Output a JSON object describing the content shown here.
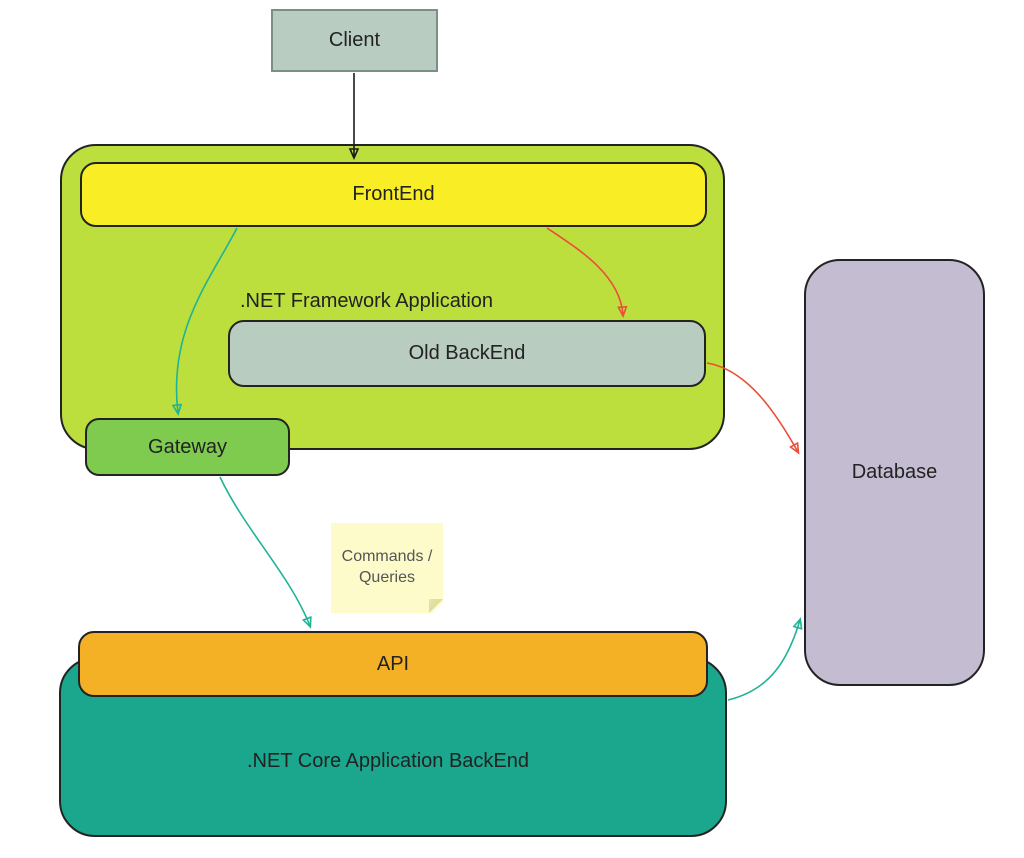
{
  "nodes": {
    "client": {
      "label": "Client"
    },
    "frontend": {
      "label": "FrontEnd"
    },
    "net_framework_app": {
      "label": ".NET Framework Application"
    },
    "old_backend": {
      "label": "Old BackEnd"
    },
    "gateway": {
      "label": "Gateway"
    },
    "api": {
      "label": "API"
    },
    "net_core_backend": {
      "label": ".NET Core Application BackEnd"
    },
    "database": {
      "label": "Database"
    }
  },
  "notes": {
    "commands_queries": {
      "text": "Commands / Queries"
    }
  },
  "colors": {
    "client_fill": "#b9ccc2",
    "client_stroke": "#7a8f85",
    "framework_fill": "#bcdf3e",
    "framework_stroke": "#232323",
    "frontend_fill": "#f9ee26",
    "frontend_stroke": "#232323",
    "old_backend_fill": "#b8ccc0",
    "old_backend_stroke": "#232323",
    "gateway_fill": "#7ecb4f",
    "gateway_stroke": "#232323",
    "core_fill": "#1aa78e",
    "core_stroke": "#232323",
    "api_fill": "#f4b125",
    "api_stroke": "#232323",
    "database_fill": "#c4bcd1",
    "database_stroke": "#232323",
    "arrow_black": "#1a1a1a",
    "arrow_teal": "#1fb395",
    "arrow_red": "#ec4e36"
  },
  "edges": [
    {
      "from": "client",
      "to": "frontend",
      "color": "black"
    },
    {
      "from": "frontend",
      "to": "gateway",
      "color": "teal"
    },
    {
      "from": "frontend",
      "to": "old_backend",
      "color": "red"
    },
    {
      "from": "old_backend",
      "to": "database",
      "color": "red"
    },
    {
      "from": "gateway",
      "to": "api",
      "color": "teal",
      "label": "commands_queries"
    },
    {
      "from": "net_core_backend",
      "to": "database",
      "color": "teal"
    }
  ]
}
